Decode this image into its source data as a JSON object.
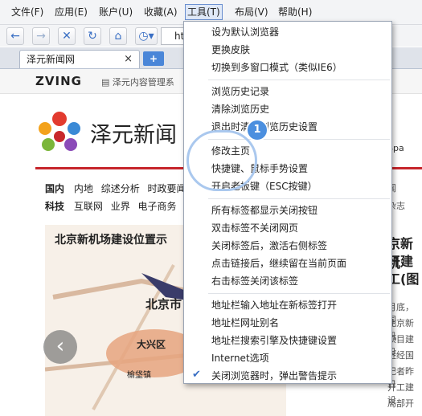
{
  "menubar": {
    "items": [
      {
        "label": "文件(F)"
      },
      {
        "label": "应用(E)"
      },
      {
        "label": "账户(U)"
      },
      {
        "label": "收藏(A)"
      },
      {
        "label": "工具(T)"
      },
      {
        "label": "布局(V)"
      },
      {
        "label": "帮助(H)"
      }
    ]
  },
  "toolbar": {
    "address_partial": "ht"
  },
  "tabs": {
    "tab1": "泽元新闻网",
    "close": "×",
    "new": "+"
  },
  "page": {
    "brand": "ZVING",
    "brand_link": "泽元内容管理系",
    "site_name": "泽元新闻",
    "nav1_head": "国内",
    "nav1_items": [
      "内地",
      "综述分析",
      "时政要闻"
    ],
    "nav2_head": "科技",
    "nav2_items": [
      "互联网",
      "业界",
      "电子商务"
    ],
    "feature_title": "北京新机场建设位置示",
    "map_label_beijing": "北京市",
    "map_label_daxing": "大兴区",
    "map_label_town": "榆垡镇",
    "right_headline": [
      "京新机",
      "开建",
      "工(图"
    ],
    "right_snips": [
      "月底，国",
      "北京新机",
      "项目建设",
      "近经国",
      "记者昨日",
      "开工建设",
      "局部开"
    ],
    "right_nav": [
      "闻",
      "杂志"
    ],
    "search_frag": "Spa"
  },
  "tools_menu": {
    "groups": [
      [
        "设为默认浏览器",
        "更换皮肤",
        "切换到多窗口模式（类似IE6）"
      ],
      [
        "浏览历史记录",
        "清除浏览历史",
        "退出时清除浏览历史设置"
      ],
      [
        "修改主页",
        "快捷键、鼠标手势设置",
        "开启老板键（ESC按键）"
      ],
      [
        "所有标签都显示关闭按钮",
        "双击标签不关闭网页",
        "关闭标签后，激活右侧标签",
        "点击链接后，继续留在当前页面",
        "右击标签关闭该标签"
      ],
      [
        "地址栏输入地址在新标签打开",
        "地址栏网址别名",
        "地址栏搜索引擎及快捷键设置",
        "Internet选项",
        "关闭浏览器时，弹出警告提示"
      ]
    ],
    "checked_item": "关闭浏览器时，弹出警告提示",
    "step_badge": "1"
  }
}
